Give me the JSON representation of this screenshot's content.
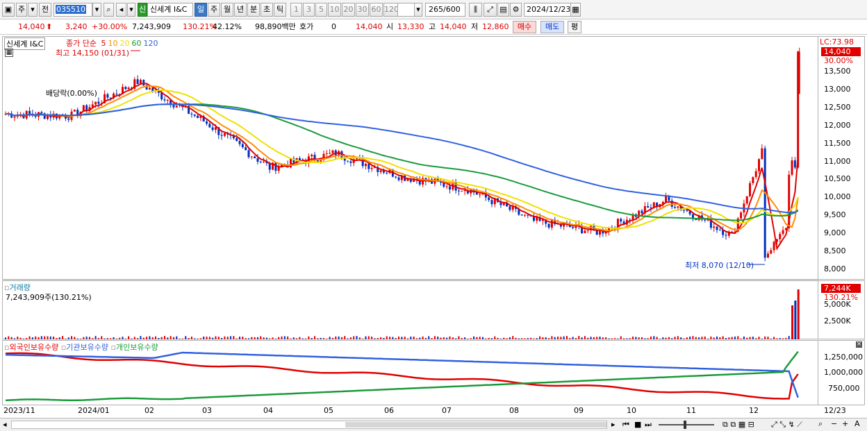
{
  "toolbar": {
    "period_a": "주",
    "period_b": "전",
    "code": "035510",
    "stock_badge": "신",
    "stock_name": "신세계 I&C",
    "periods": [
      "일",
      "주",
      "월",
      "년",
      "분",
      "초",
      "틱"
    ],
    "active_period": "일",
    "intervals": [
      "1",
      "3",
      "5",
      "10",
      "20",
      "30",
      "60",
      "120"
    ],
    "count": "265",
    "count_total": "/600",
    "date": "2024/12/23"
  },
  "quote": {
    "price": "14,040",
    "change": "3,240",
    "change_pct": "+30.00%",
    "volume": "7,243,909",
    "volume_ratio": "130.21%",
    "turnover_ratio": "42.12%",
    "amount": "98,890백만",
    "bid_label": "호가",
    "bid_value": "0",
    "last": "14,040",
    "open_label": "시",
    "open": "13,330",
    "high_label": "고",
    "high": "14,040",
    "low_label": "저",
    "low": "12,860",
    "buy_button": "매수",
    "sell_button": "매도",
    "avg_button": "평"
  },
  "price_panel": {
    "name_tag": "신세계 I&C",
    "ma_label": "종가 단순",
    "ma_periods": [
      "5",
      "10",
      "20",
      "60",
      "120"
    ],
    "ma_colors": [
      "#e00000",
      "#ff8c00",
      "#f0e000",
      "#1a9a3a",
      "#3060e0"
    ],
    "annotation_high": "최고 14,150 (01/31)",
    "annotation_dividend": "배당락(0.00%)",
    "annotation_low": "최저 8,070 (12/10)",
    "lc_label": "LC:73.98",
    "last_tag": "14,040",
    "last_pct": "30.00%",
    "y_ticks": [
      "13,500",
      "13,000",
      "12,500",
      "12,000",
      "11,500",
      "11,000",
      "10,500",
      "10,000",
      "9,500",
      "9,000",
      "8,500",
      "8,000"
    ]
  },
  "volume_panel": {
    "title": "거래량",
    "value_text": "7,243,909주(130.21%)",
    "last_tag": "7,244K",
    "last_pct": "130.21%",
    "y_ticks": [
      "5,000K",
      "2,500K"
    ]
  },
  "holding_panel": {
    "series": [
      "외국인보유수량",
      "기관보유수량",
      "개인보유수량"
    ],
    "colors": [
      "#e00000",
      "#3060e0",
      "#1a9a3a"
    ],
    "y_ticks": [
      "1,250,000",
      "1,000,000",
      "750,000"
    ]
  },
  "x_axis": {
    "labels": [
      "2023/11",
      "2024/01",
      "02",
      "03",
      "04",
      "05",
      "06",
      "07",
      "08",
      "09",
      "10",
      "11",
      "12",
      "12/23"
    ]
  },
  "chart_data": {
    "type": "candlestick",
    "y_range": [
      7800,
      14300
    ],
    "last_close": 14040,
    "high": {
      "value": 14150,
      "date": "01/31"
    },
    "low": {
      "value": 8070,
      "date": "12/10"
    },
    "monthly_close_approx": [
      {
        "x": "2023/11",
        "close": 12300
      },
      {
        "x": "2024/01",
        "close": 12250
      },
      {
        "x": "02",
        "close": 13200
      },
      {
        "x": "03",
        "close": 12100
      },
      {
        "x": "04",
        "close": 10800
      },
      {
        "x": "05",
        "close": 11200
      },
      {
        "x": "06",
        "close": 10550
      },
      {
        "x": "07",
        "close": 10200
      },
      {
        "x": "08",
        "close": 9300
      },
      {
        "x": "09",
        "close": 9000
      },
      {
        "x": "10",
        "close": 9900
      },
      {
        "x": "11",
        "close": 8900
      },
      {
        "x": "12",
        "close": 14040
      }
    ]
  }
}
